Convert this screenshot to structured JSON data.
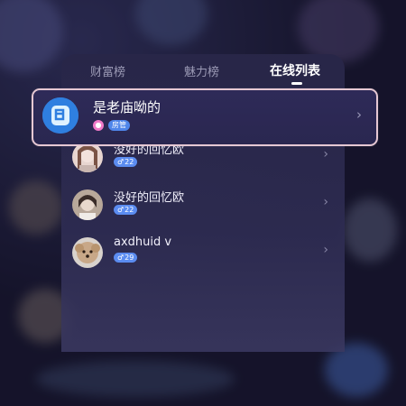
{
  "tabs": [
    {
      "label": "财富榜"
    },
    {
      "label": "魅力榜"
    },
    {
      "label": "在线列表"
    }
  ],
  "active_tab": "在线列表",
  "top_user": {
    "name": "是老庙呦的",
    "role_badge": "房管",
    "icon": "pink-circle-icon",
    "chevron": "›"
  },
  "users": [
    {
      "name": "没好的回忆欧",
      "gender_symbol": "♂",
      "age": "22",
      "chevron": "›"
    },
    {
      "name": "没好的回忆欧",
      "gender_symbol": "♂",
      "age": "22",
      "chevron": "›"
    },
    {
      "name": "axdhuid v",
      "gender_symbol": "♂",
      "age": "29",
      "chevron": "›"
    }
  ],
  "colors": {
    "accent_badge": "#5b8cf0",
    "highlight_border": "#e6c8d3",
    "panel_bg": "#2d2b4f"
  }
}
